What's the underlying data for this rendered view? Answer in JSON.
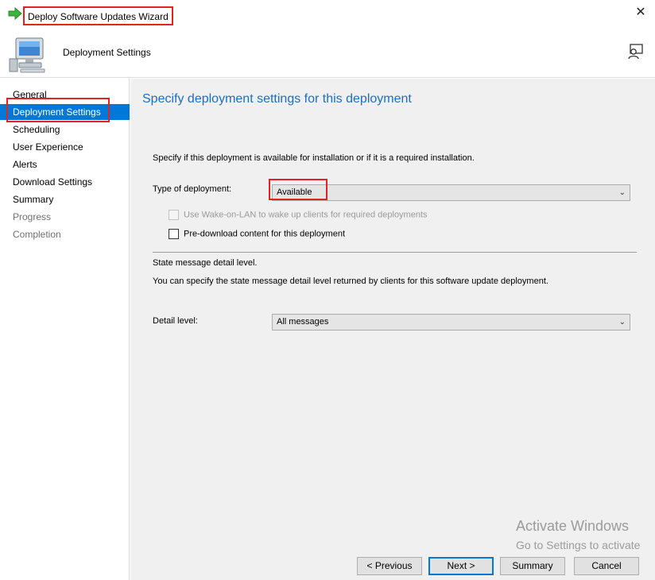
{
  "window": {
    "title": "Deploy Software Updates Wizard",
    "close_glyph": "✕"
  },
  "header": {
    "title": "Deployment Settings",
    "icon": "computer-icon",
    "help_icon": "help-icon"
  },
  "sidebar": {
    "items": [
      {
        "label": "General",
        "state": "normal"
      },
      {
        "label": "Deployment Settings",
        "state": "active"
      },
      {
        "label": "Scheduling",
        "state": "normal"
      },
      {
        "label": "User Experience",
        "state": "normal"
      },
      {
        "label": "Alerts",
        "state": "normal"
      },
      {
        "label": "Download Settings",
        "state": "normal"
      },
      {
        "label": "Summary",
        "state": "normal"
      },
      {
        "label": "Progress",
        "state": "disabled"
      },
      {
        "label": "Completion",
        "state": "disabled"
      }
    ]
  },
  "main": {
    "heading": "Specify deployment settings for this deployment",
    "intro": "Specify if this deployment is available for installation or if it is a required installation.",
    "type_label": "Type of deployment:",
    "type_value": "Available",
    "wake_on_lan_label": "Use Wake-on-LAN to wake up clients for required deployments",
    "wake_on_lan_checked": false,
    "wake_on_lan_enabled": false,
    "predownload_label": "Pre-download content for this deployment",
    "predownload_checked": false,
    "state_title": "State message detail level.",
    "state_desc": "You can specify the state message detail level returned by clients for this software update deployment.",
    "detail_label": "Detail level:",
    "detail_value": "All messages"
  },
  "watermark": {
    "line1": "Activate Windows",
    "line2": "Go to Settings to activate"
  },
  "buttons": {
    "previous": "< Previous",
    "next": "Next >",
    "summary": "Summary",
    "cancel": "Cancel"
  },
  "colors": {
    "accent": "#0078d7",
    "highlight_outline": "#e32222",
    "heading": "#1a6fc2"
  }
}
